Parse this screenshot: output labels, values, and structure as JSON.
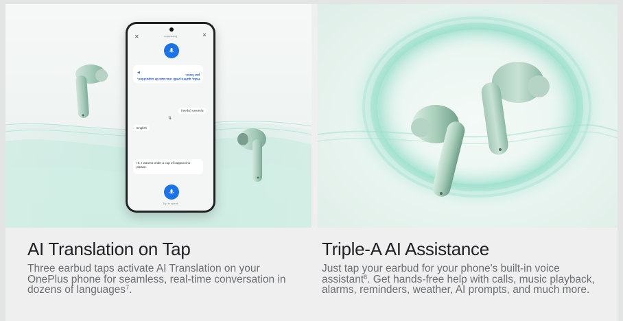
{
  "cards": [
    {
      "title": "AI Translation on Tap",
      "body": "Three earbud taps activate AI Translation on your OnePlus phone for seamless, real-time conversation in dozens of languages",
      "footnote": "7",
      "body_end": ".",
      "phone": {
        "screen_title": "Translation",
        "incoming_text": "Hola, quiero pedir una taza de capuchino, por favor.",
        "target_language": "Spanish (Spain)",
        "source_language": "English",
        "outgoing_text": "Hi, I want to order a cup of cappuccino please.",
        "tap_hint": "Tap to speak",
        "mute_icon_glyph": "✕",
        "close_icon_glyph": "×",
        "swap_glyph": "⇅",
        "speaker_glyph": "◀"
      }
    },
    {
      "title": "Triple-A AI Assistance",
      "body": "Just tap your earbud for your phone's built-in voice assistant",
      "footnote": "8",
      "body_end": ". Get hands-free help with calls, music playback, alarms, reminders, weather, AI prompts, and much more."
    }
  ],
  "colors": {
    "accent_blue": "#1a73e8",
    "earbud_green": "#9fc9b7",
    "wave_teal": "#6ccfb5"
  },
  "icons": [
    "mute-icon",
    "close-icon",
    "mic-icon",
    "swap-icon",
    "speaker-icon"
  ]
}
